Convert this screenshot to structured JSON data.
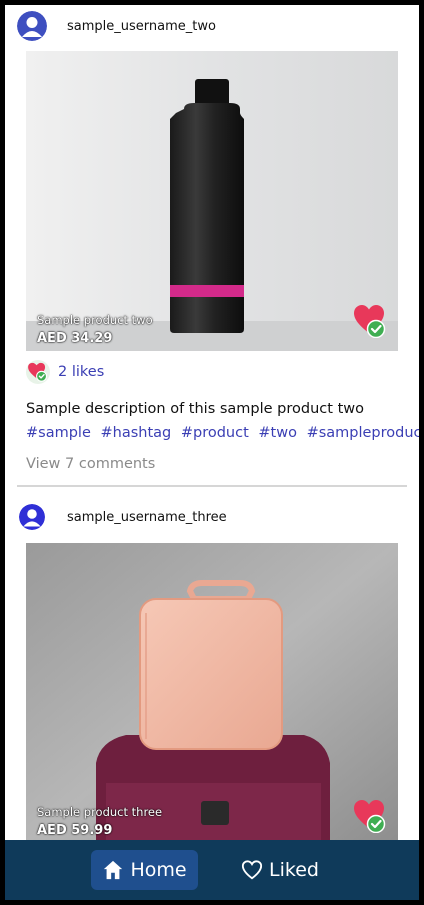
{
  "posts": [
    {
      "username": "sample_username_two",
      "product_name": "Sample product two",
      "price": "AED 34.29",
      "likes": "2 likes",
      "description": "Sample description of this sample product two",
      "hashtags": [
        "#sample",
        "#hashtag",
        "#product",
        "#two",
        "#sampleproducttwo"
      ],
      "comments_link": "View 7 comments",
      "liked": true
    },
    {
      "username": "sample_username_three",
      "product_name": "Sample product three",
      "price": "AED 59.99",
      "liked": true
    }
  ],
  "nav": {
    "home_label": "Home",
    "liked_label": "Liked",
    "active": "home"
  },
  "colors": {
    "link": "#3b3fb4",
    "nav_bg": "#0f3a5a",
    "nav_active": "#1f4f8e",
    "heart": "#e8385a",
    "check": "#3fae52"
  },
  "icons": {
    "avatar": "user-avatar-icon",
    "like_badge": "heart-check-icon",
    "home": "home-icon",
    "liked": "heart-outline-icon"
  }
}
